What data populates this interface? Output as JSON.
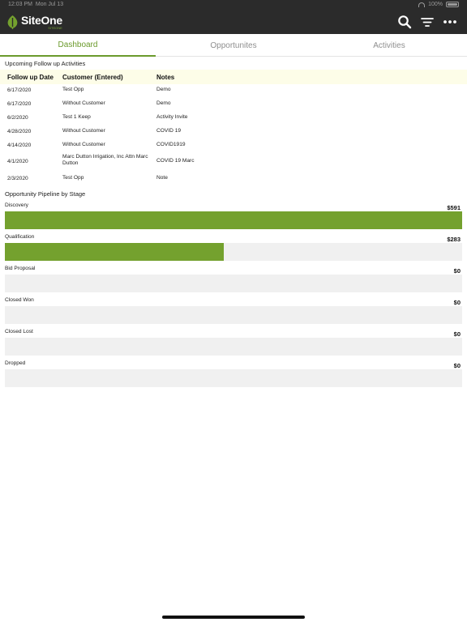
{
  "status_bar": {
    "time": "12:03 PM",
    "date": "Mon Jul 13",
    "battery": "100%"
  },
  "app": {
    "brand_name": "SiteOne",
    "brand_sub": "SITEONE"
  },
  "tabs": [
    {
      "label": "Dashboard",
      "active": true
    },
    {
      "label": "Opportunites",
      "active": false
    },
    {
      "label": "Activities",
      "active": false
    }
  ],
  "followups": {
    "title": "Upcoming Follow up Activities",
    "headers": [
      "Follow up Date",
      "Customer (Entered)",
      "Notes"
    ],
    "rows": [
      {
        "date": "6/17/2020",
        "customer": "Test Opp",
        "notes": "Demo"
      },
      {
        "date": "6/17/2020",
        "customer": "Without Customer",
        "notes": "Demo"
      },
      {
        "date": "6/2/2020",
        "customer": "Test 1 Keep",
        "notes": "Activity Invite"
      },
      {
        "date": "4/28/2020",
        "customer": "Without Customer",
        "notes": "COVID 19"
      },
      {
        "date": "4/14/2020",
        "customer": "Without Customer",
        "notes": "COVID1919"
      },
      {
        "date": "4/1/2020",
        "customer": "Marc Dutton Irrigation, Inc  Attn Marc Dutton",
        "notes": "COVID 19 Marc"
      },
      {
        "date": "2/3/2020",
        "customer": "Test Opp",
        "notes": "Note"
      }
    ]
  },
  "pipeline": {
    "title": "Opportunity Pipeline by Stage",
    "stages": [
      {
        "label": "Discovery",
        "value": "$591",
        "fill": 1.0
      },
      {
        "label": "Qualification",
        "value": "$283",
        "fill": 0.479
      },
      {
        "label": "Bid Proposal",
        "value": "$0",
        "fill": 0
      },
      {
        "label": "Closed Won",
        "value": "$0",
        "fill": 0
      },
      {
        "label": "Closed Lost",
        "value": "$0",
        "fill": 0
      },
      {
        "label": "Dropped",
        "value": "$0",
        "fill": 0
      }
    ]
  },
  "colors": {
    "accent": "#74a12e",
    "topbar": "#2b2b2b",
    "track": "#f0f0f0",
    "header_bg": "#fdfde8"
  },
  "icons": {
    "search": "search-icon",
    "filter": "filter-icon",
    "more": "more-icon"
  }
}
